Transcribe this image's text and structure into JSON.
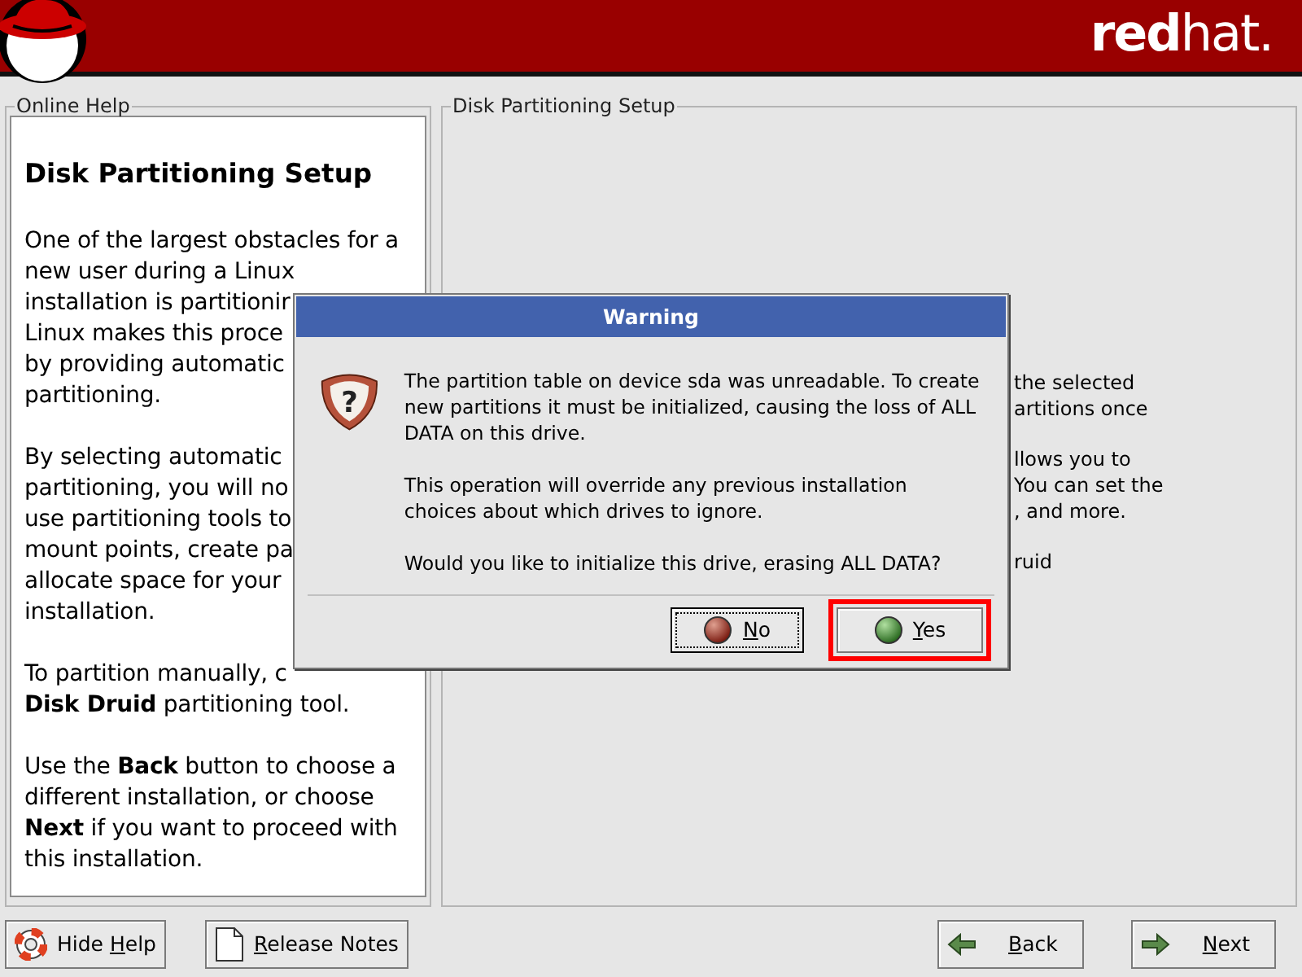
{
  "header": {
    "brand_bold": "red",
    "brand_light": "hat."
  },
  "help_panel": {
    "frame_label": "Online Help",
    "heading": "Disk Partitioning Setup",
    "paragraphs": [
      [
        "One of the largest obstacles for a",
        "new user during a Linux",
        "installation is partitionir",
        "Linux makes this proce",
        "by providing automatic",
        "partitioning."
      ],
      [
        "By selecting automatic",
        "partitioning, you will no",
        "use partitioning tools to",
        "mount points, create pa",
        "allocate space for your",
        "installation."
      ],
      [
        "To partition manually, c",
        "**Disk Druid** partitioning tool."
      ],
      [
        "Use the **Back** button to choose a",
        "different installation, or choose",
        "**Next** if you want to proceed with",
        "this installation."
      ]
    ]
  },
  "setup_panel": {
    "frame_label": "Disk Partitioning Setup",
    "paragraphs": [
      [
        "the selected",
        "artitions once"
      ],
      [
        "llows you to",
        "You can set the",
        ", and more."
      ],
      [
        "ruid"
      ]
    ]
  },
  "dialog": {
    "title": "Warning",
    "icon_glyph": "?",
    "paragraphs": [
      "The partition table on device sda was unreadable. To create new partitions it must be initialized, causing the loss of ALL DATA on this drive.",
      "This operation will override any previous installation choices about which drives to ignore.",
      "Would you like to initialize this drive, erasing ALL DATA?"
    ],
    "buttons": [
      {
        "label": {
          "key": "N",
          "rest": "o"
        },
        "kind": "no",
        "focused": true,
        "highlighted": false
      },
      {
        "label": {
          "key": "Y",
          "rest": "es"
        },
        "kind": "yes",
        "focused": false,
        "highlighted": true
      }
    ]
  },
  "bottom_buttons": [
    {
      "label": {
        "before": "Hide ",
        "key": "H",
        "rest": "elp"
      },
      "kind": "help"
    },
    {
      "label": {
        "key": "R",
        "rest": "elease Notes"
      },
      "kind": "notes"
    },
    {
      "label": {
        "key": "B",
        "rest": "ack"
      },
      "kind": "back"
    },
    {
      "label": {
        "key": "N",
        "rest": "ext"
      },
      "kind": "next"
    }
  ]
}
